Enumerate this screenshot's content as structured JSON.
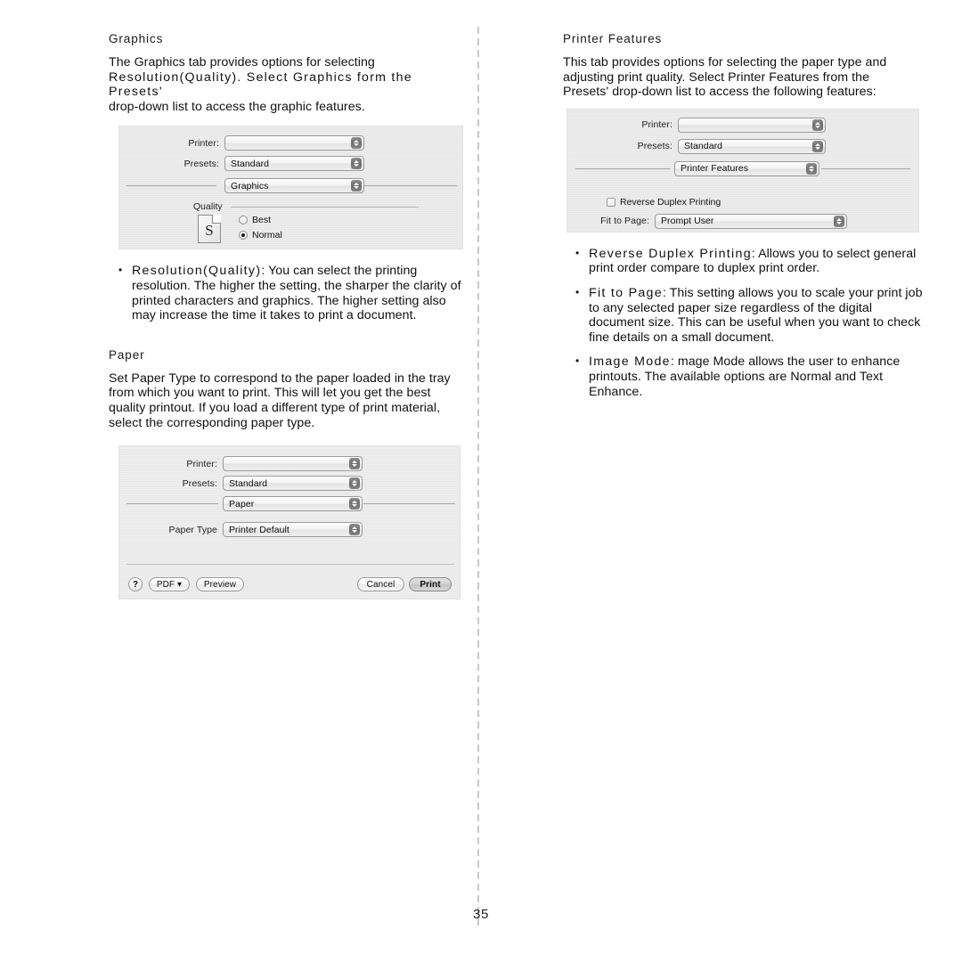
{
  "page": {
    "number": "35",
    "divider_color": "#c9c9c9"
  },
  "left_column": {
    "section1": {
      "heading": "Graphics",
      "paragraph_lines": [
        "The Graphics tab provides options for selecting",
        "Resolution(Quality). Select Graphics form the Presets'",
        "drop-down list to access the graphic features."
      ],
      "dialog": {
        "printer_label": "Printer:",
        "printer_value": "",
        "presets_label": "Presets:",
        "presets_value": "Standard",
        "pane_value": "Graphics",
        "quality_group_label": "Quality",
        "doc_icon_letter": "S",
        "radio_best": "Best",
        "radio_normal": "Normal",
        "selected_quality": "Normal"
      },
      "bullets": [
        {
          "term": "Resolution(Quality)",
          "text": ": You can select the printing resolution. The higher the setting, the sharper the clarity of printed characters and graphics. The higher setting also may increase the time it takes to print a document."
        }
      ]
    },
    "section2": {
      "heading": "Paper",
      "paragraph_lines": [
        "Set Paper Type to correspond to the paper loaded in the tray",
        "from which you want to print. This will let you get the best",
        "quality printout. If you load a different type of print material,",
        "select the corresponding paper type."
      ],
      "dialog": {
        "printer_label": "Printer:",
        "printer_value": "",
        "presets_label": "Presets:",
        "presets_value": "Standard",
        "pane_value": "Paper",
        "paper_type_label": "Paper Type",
        "paper_type_value": "Printer Default",
        "help_label": "?",
        "pdf_label": "PDF ▾",
        "preview_label": "Preview",
        "cancel_label": "Cancel",
        "print_label": "Print"
      }
    }
  },
  "right_column": {
    "section1": {
      "heading": "Printer Features",
      "paragraph_lines": [
        "This tab provides options for selecting the paper type and",
        "adjusting print quality. Select Printer Features from the",
        "Presets' drop-down list to access the following features:"
      ],
      "dialog": {
        "printer_label": "Printer:",
        "printer_value": "",
        "presets_label": "Presets:",
        "presets_value": "Standard",
        "pane_value": "Printer Features",
        "reverse_duplex_label": "Reverse Duplex Printing",
        "reverse_duplex_checked": false,
        "fit_to_page_label": "Fit to Page:",
        "fit_to_page_value": "Prompt User"
      },
      "bullets": [
        {
          "term": "Reverse Duplex Printing",
          "text": ": Allows you to select general print order compare to duplex print order."
        },
        {
          "term": "Fit to Page",
          "text": ": This setting allows you to scale your print job to any selected paper size regardless of the digital document size. This can be useful when you want to check fine details on a small document."
        },
        {
          "term": "Image Mode",
          "text": ": mage Mode allows the user to enhance printouts. The available options are Normal and Text Enhance."
        }
      ]
    }
  }
}
